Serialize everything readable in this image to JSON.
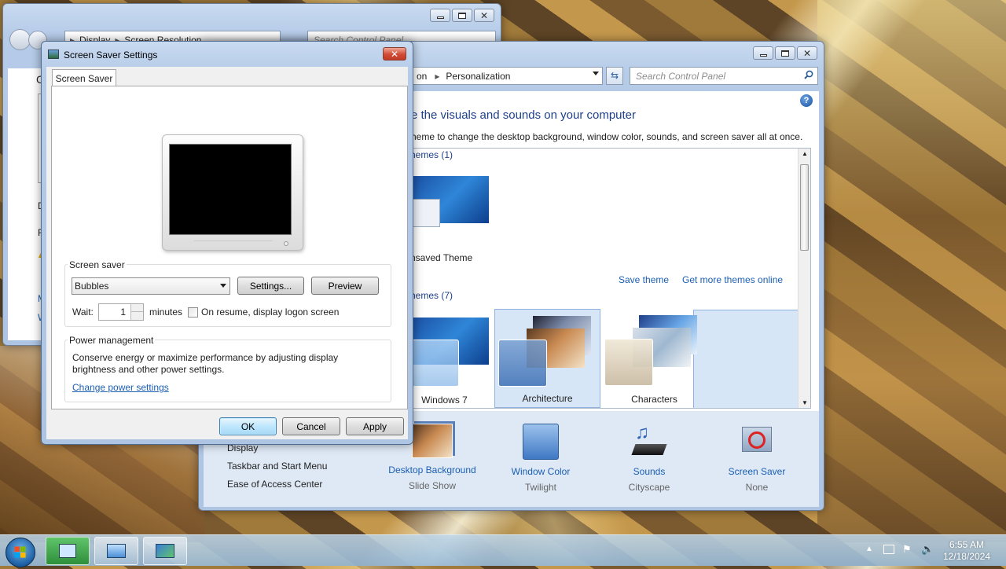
{
  "back_window": {
    "breadcrumb": [
      "Display",
      "Screen Resolution"
    ],
    "search_placeholder": "Search Control Panel",
    "partial_chars": [
      "C",
      "D",
      "R",
      "M",
      "W"
    ]
  },
  "personalization": {
    "breadcrumb_tail": "on",
    "breadcrumb_current": "Personalization",
    "search_placeholder": "Search Control Panel",
    "heading": "e the visuals and sounds on your computer",
    "subheading": "heme to change the desktop background, window color, sounds, and screen saver all at once.",
    "my_themes_label": "hemes (1)",
    "unsaved_theme": "nsaved Theme",
    "save_theme": "Save theme",
    "get_more_themes": "Get more themes online",
    "aero_themes_label": "hemes (7)",
    "themes": [
      "Windows 7",
      "Architecture",
      "Characters"
    ],
    "see_also": [
      "Display",
      "Taskbar and Start Menu",
      "Ease of Access Center"
    ],
    "bottom_items": [
      {
        "title": "Desktop Background",
        "sub": "Slide Show"
      },
      {
        "title": "Window Color",
        "sub": "Twilight"
      },
      {
        "title": "Sounds",
        "sub": "Cityscape"
      },
      {
        "title": "Screen Saver",
        "sub": "None"
      }
    ]
  },
  "dialog": {
    "title": "Screen Saver Settings",
    "tab": "Screen Saver",
    "screen_saver_group": "Screen saver",
    "selected_saver": "Bubbles",
    "settings_btn": "Settings...",
    "preview_btn": "Preview",
    "wait_label": "Wait:",
    "wait_value": "1",
    "minutes_label": "minutes",
    "logon_checkbox": "On resume, display logon screen",
    "logon_checked": false,
    "power_group": "Power management",
    "power_text_1": "Conserve energy or maximize performance by adjusting display",
    "power_text_2": "brightness and other power settings.",
    "power_link": "Change power settings",
    "ok": "OK",
    "cancel": "Cancel",
    "apply": "Apply"
  },
  "taskbar": {
    "time": "6:55 AM",
    "date": "12/18/2024"
  },
  "colors": {
    "link": "#1b5fb3",
    "accent_blue": "#3c7fb1"
  }
}
